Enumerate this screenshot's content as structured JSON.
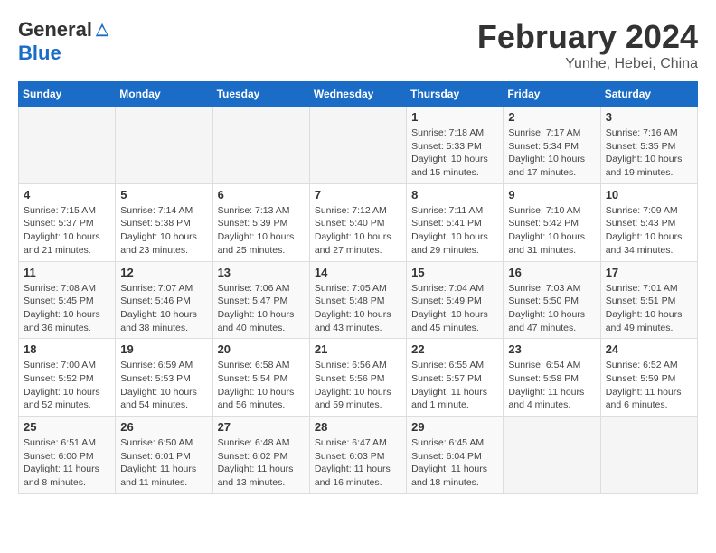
{
  "header": {
    "logo": {
      "general": "General",
      "blue": "Blue"
    },
    "title": "February 2024",
    "location": "Yunhe, Hebei, China"
  },
  "days_of_week": [
    "Sunday",
    "Monday",
    "Tuesday",
    "Wednesday",
    "Thursday",
    "Friday",
    "Saturday"
  ],
  "weeks": [
    [
      {
        "day": null,
        "info": null
      },
      {
        "day": null,
        "info": null
      },
      {
        "day": null,
        "info": null
      },
      {
        "day": null,
        "info": null
      },
      {
        "day": "1",
        "info": "Sunrise: 7:18 AM\nSunset: 5:33 PM\nDaylight: 10 hours\nand 15 minutes."
      },
      {
        "day": "2",
        "info": "Sunrise: 7:17 AM\nSunset: 5:34 PM\nDaylight: 10 hours\nand 17 minutes."
      },
      {
        "day": "3",
        "info": "Sunrise: 7:16 AM\nSunset: 5:35 PM\nDaylight: 10 hours\nand 19 minutes."
      }
    ],
    [
      {
        "day": "4",
        "info": "Sunrise: 7:15 AM\nSunset: 5:37 PM\nDaylight: 10 hours\nand 21 minutes."
      },
      {
        "day": "5",
        "info": "Sunrise: 7:14 AM\nSunset: 5:38 PM\nDaylight: 10 hours\nand 23 minutes."
      },
      {
        "day": "6",
        "info": "Sunrise: 7:13 AM\nSunset: 5:39 PM\nDaylight: 10 hours\nand 25 minutes."
      },
      {
        "day": "7",
        "info": "Sunrise: 7:12 AM\nSunset: 5:40 PM\nDaylight: 10 hours\nand 27 minutes."
      },
      {
        "day": "8",
        "info": "Sunrise: 7:11 AM\nSunset: 5:41 PM\nDaylight: 10 hours\nand 29 minutes."
      },
      {
        "day": "9",
        "info": "Sunrise: 7:10 AM\nSunset: 5:42 PM\nDaylight: 10 hours\nand 31 minutes."
      },
      {
        "day": "10",
        "info": "Sunrise: 7:09 AM\nSunset: 5:43 PM\nDaylight: 10 hours\nand 34 minutes."
      }
    ],
    [
      {
        "day": "11",
        "info": "Sunrise: 7:08 AM\nSunset: 5:45 PM\nDaylight: 10 hours\nand 36 minutes."
      },
      {
        "day": "12",
        "info": "Sunrise: 7:07 AM\nSunset: 5:46 PM\nDaylight: 10 hours\nand 38 minutes."
      },
      {
        "day": "13",
        "info": "Sunrise: 7:06 AM\nSunset: 5:47 PM\nDaylight: 10 hours\nand 40 minutes."
      },
      {
        "day": "14",
        "info": "Sunrise: 7:05 AM\nSunset: 5:48 PM\nDaylight: 10 hours\nand 43 minutes."
      },
      {
        "day": "15",
        "info": "Sunrise: 7:04 AM\nSunset: 5:49 PM\nDaylight: 10 hours\nand 45 minutes."
      },
      {
        "day": "16",
        "info": "Sunrise: 7:03 AM\nSunset: 5:50 PM\nDaylight: 10 hours\nand 47 minutes."
      },
      {
        "day": "17",
        "info": "Sunrise: 7:01 AM\nSunset: 5:51 PM\nDaylight: 10 hours\nand 49 minutes."
      }
    ],
    [
      {
        "day": "18",
        "info": "Sunrise: 7:00 AM\nSunset: 5:52 PM\nDaylight: 10 hours\nand 52 minutes."
      },
      {
        "day": "19",
        "info": "Sunrise: 6:59 AM\nSunset: 5:53 PM\nDaylight: 10 hours\nand 54 minutes."
      },
      {
        "day": "20",
        "info": "Sunrise: 6:58 AM\nSunset: 5:54 PM\nDaylight: 10 hours\nand 56 minutes."
      },
      {
        "day": "21",
        "info": "Sunrise: 6:56 AM\nSunset: 5:56 PM\nDaylight: 10 hours\nand 59 minutes."
      },
      {
        "day": "22",
        "info": "Sunrise: 6:55 AM\nSunset: 5:57 PM\nDaylight: 11 hours\nand 1 minute."
      },
      {
        "day": "23",
        "info": "Sunrise: 6:54 AM\nSunset: 5:58 PM\nDaylight: 11 hours\nand 4 minutes."
      },
      {
        "day": "24",
        "info": "Sunrise: 6:52 AM\nSunset: 5:59 PM\nDaylight: 11 hours\nand 6 minutes."
      }
    ],
    [
      {
        "day": "25",
        "info": "Sunrise: 6:51 AM\nSunset: 6:00 PM\nDaylight: 11 hours\nand 8 minutes."
      },
      {
        "day": "26",
        "info": "Sunrise: 6:50 AM\nSunset: 6:01 PM\nDaylight: 11 hours\nand 11 minutes."
      },
      {
        "day": "27",
        "info": "Sunrise: 6:48 AM\nSunset: 6:02 PM\nDaylight: 11 hours\nand 13 minutes."
      },
      {
        "day": "28",
        "info": "Sunrise: 6:47 AM\nSunset: 6:03 PM\nDaylight: 11 hours\nand 16 minutes."
      },
      {
        "day": "29",
        "info": "Sunrise: 6:45 AM\nSunset: 6:04 PM\nDaylight: 11 hours\nand 18 minutes."
      },
      {
        "day": null,
        "info": null
      },
      {
        "day": null,
        "info": null
      }
    ]
  ]
}
